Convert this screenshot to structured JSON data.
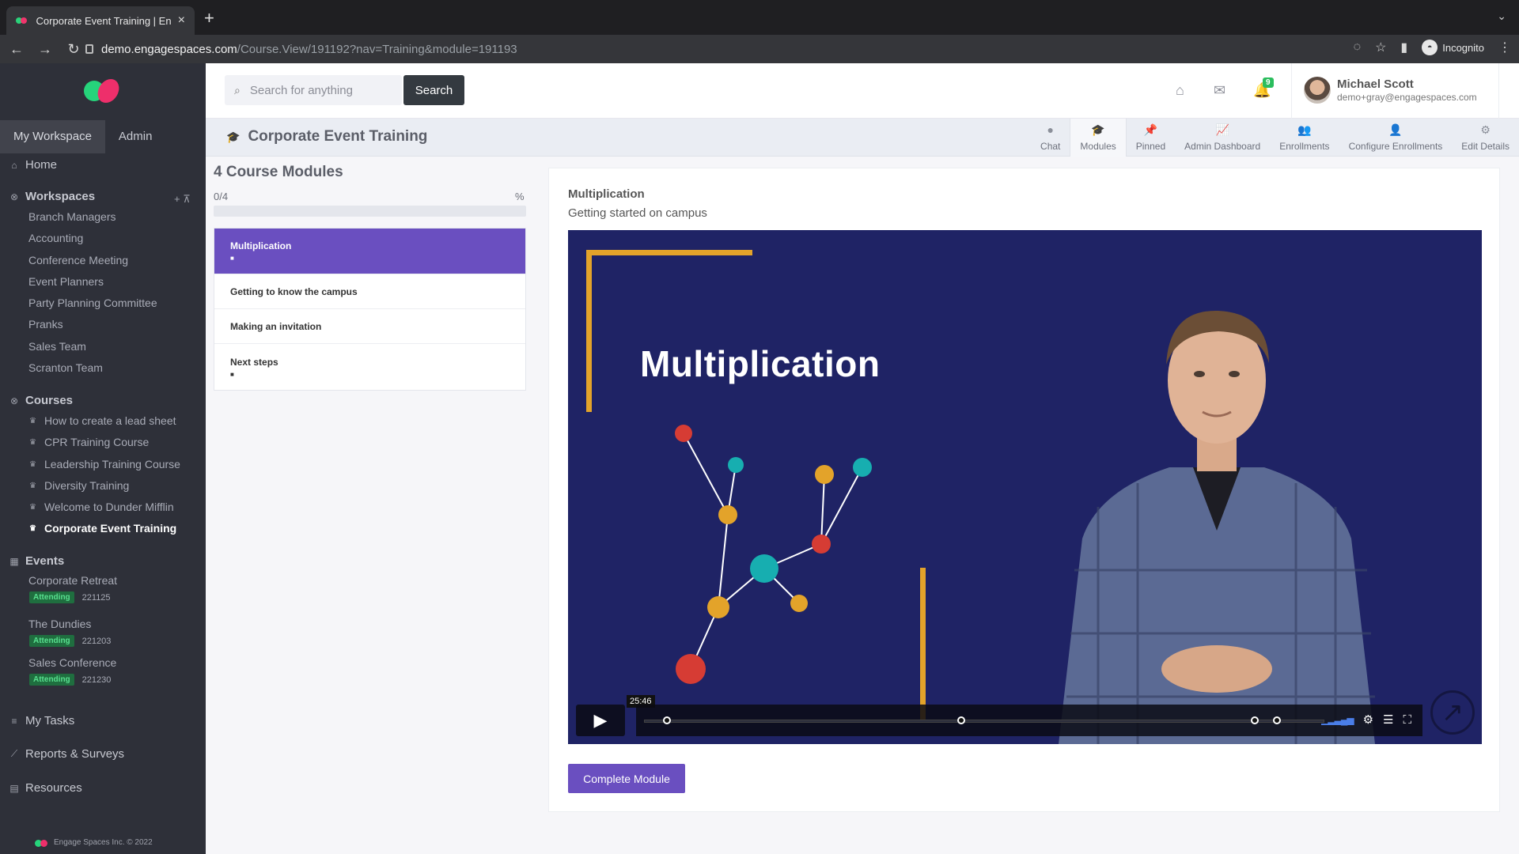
{
  "browser": {
    "tab_title": "Corporate Event Training | Engage",
    "url_host": "demo.engagespaces.com",
    "url_path": "/Course.View/191192?nav=Training&module=191193",
    "profile_label": "Incognito"
  },
  "sidebar": {
    "tabs": [
      "My Workspace",
      "Admin"
    ],
    "home_label": "Home",
    "workspaces_heading": "Workspaces",
    "workspaces": [
      "Branch Managers",
      "Accounting",
      "Conference Meeting",
      "Event Planners",
      "Party Planning Committee",
      "Pranks",
      "Sales Team",
      "Scranton Team"
    ],
    "courses_heading": "Courses",
    "courses": [
      "How to create a lead sheet",
      "CPR Training Course",
      "Leadership Training Course",
      "Diversity Training",
      "Welcome to Dunder Mifflin",
      "Corporate Event Training"
    ],
    "active_course": "Corporate Event Training",
    "events_heading": "Events",
    "events": [
      {
        "name": "Corporate Retreat",
        "status": "Attending",
        "date": "221125"
      },
      {
        "name": "The Dundies",
        "status": "Attending",
        "date": "221203"
      },
      {
        "name": "Sales Conference",
        "status": "Attending",
        "date": "221230"
      }
    ],
    "tasks_label": "My Tasks",
    "reports_label": "Reports & Surveys",
    "resources_label": "Resources",
    "footer": "Engage Spaces Inc. © 2022"
  },
  "header": {
    "search_placeholder": "Search for anything",
    "search_button": "Search",
    "notification_count": "9",
    "user_name": "Michael Scott",
    "user_email": "demo+gray@engagespaces.com"
  },
  "subheader": {
    "course_title": "Corporate Event Training",
    "tabs": [
      "Chat",
      "Modules",
      "Pinned",
      "Admin Dashboard",
      "Enrollments",
      "Configure Enrollments",
      "Edit Details"
    ],
    "active_tab": "Modules"
  },
  "modules": {
    "heading": "4 Course Modules",
    "progress_text": "0/4",
    "percent_symbol": "%",
    "progress_fraction": 0,
    "items": [
      {
        "title": "Multiplication",
        "has_video": true,
        "active": true
      },
      {
        "title": "Getting to know the campus",
        "has_video": false,
        "active": false
      },
      {
        "title": "Making an invitation",
        "has_video": false,
        "active": false
      },
      {
        "title": "Next steps",
        "has_video": true,
        "active": false
      }
    ]
  },
  "content": {
    "title": "Multiplication",
    "subtitle": "Getting started on campus",
    "video_heading": "Multiplication",
    "video_time": "25:46",
    "complete_button": "Complete Module"
  },
  "colors": {
    "accent": "#6a4fc0",
    "sidebar_bg": "#2e3039",
    "video_bg": "#1f2365",
    "frame_gold": "#e3a32a"
  }
}
